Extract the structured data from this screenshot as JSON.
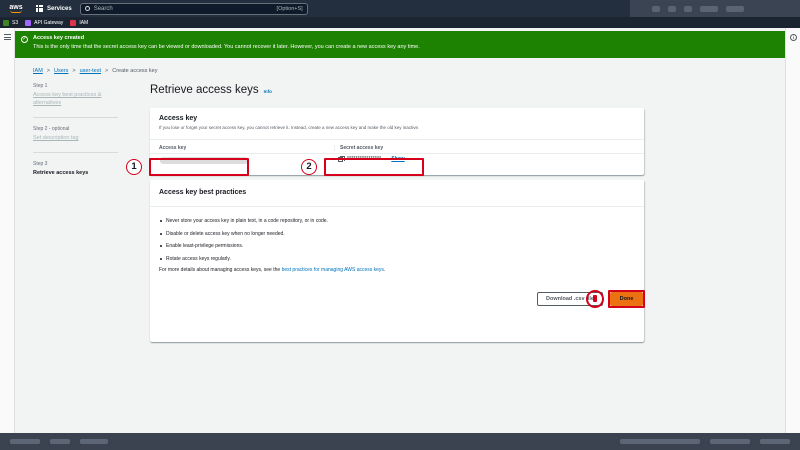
{
  "topnav": {
    "logo": "aws",
    "services_label": "Services",
    "search_placeholder": "Search",
    "search_shortcut": "[Option+S]"
  },
  "favorites": [
    {
      "label": "S3",
      "icon": "s3-icon",
      "color": "#3f8624"
    },
    {
      "label": "API Gateway",
      "icon": "api-gateway-icon",
      "color": "#a166ff"
    },
    {
      "label": "IAM",
      "icon": "iam-icon",
      "color": "#dd344c"
    }
  ],
  "flash": {
    "title": "Access key created",
    "message": "This is the only time that the secret access key can be viewed or downloaded. You cannot recover it later. However, you can create a new access key any time.",
    "color": "#1d8102"
  },
  "breadcrumb": {
    "items": [
      "IAM",
      "Users",
      "user-test"
    ],
    "current": "Create access key"
  },
  "steps": [
    {
      "label": "Step 1",
      "name": "Access key best practices & alternatives"
    },
    {
      "label": "Step 2 - optional",
      "name": "Set description tag"
    },
    {
      "label": "Step 3",
      "name": "Retrieve access keys"
    }
  ],
  "page": {
    "title": "Retrieve access keys",
    "info_link": "Info"
  },
  "access_key_card": {
    "heading": "Access key",
    "description": "If you lose or forget your secret access key, you cannot retrieve it. Instead, create a new access key and make the old key inactive.",
    "col_access_key": "Access key",
    "col_secret": "Secret access key",
    "secret_masked": "****************",
    "show_label": "Show"
  },
  "best_practices": {
    "heading": "Access key best practices",
    "items": [
      "Never store your access key in plain text, in a code repository, or in code.",
      "Disable or delete access key when no longer needed.",
      "Enable least-privilege permissions.",
      "Rotate access keys regularly."
    ],
    "more_prefix": "For more details about managing access keys, see the ",
    "more_link": "best practices for managing AWS access keys",
    "more_suffix": "."
  },
  "buttons": {
    "download": "Download .csv file",
    "done": "Done"
  },
  "annotations": [
    "1",
    "2"
  ],
  "colors": {
    "primary": "#ec7211",
    "link": "#0073bb",
    "annotation": "#d5001a",
    "nav": "#232f3e"
  }
}
